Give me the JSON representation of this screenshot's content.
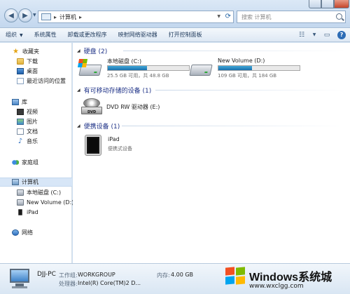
{
  "address": {
    "breadcrumb": "计算机",
    "search_placeholder": "搜索 计算机"
  },
  "toolbar": {
    "organize": "组织",
    "system_properties": "系统属性",
    "uninstall": "卸载或更改程序",
    "map_drive": "映射网络驱动器",
    "control_panel": "打开控制面板"
  },
  "sidebar": {
    "favorites": "收藏夹",
    "downloads": "下载",
    "desktop": "桌面",
    "recent": "最近访问的位置",
    "libraries": "库",
    "videos": "视频",
    "pictures": "图片",
    "documents": "文档",
    "music": "音乐",
    "homegroup": "家庭组",
    "computer": "计算机",
    "local_disk": "本地磁盘 (C:)",
    "new_volume": "New Volume (D:)",
    "ipad": "iPad",
    "network": "网络"
  },
  "content": {
    "hard_disks_header": "硬盘 (2)",
    "removable_header": "有可移动存储的设备 (1)",
    "portable_header": "便携设备 (1)",
    "drives": [
      {
        "name": "本地磁盘 (C:)",
        "space": "25.5 GB 可用，共 48.8 GB",
        "used_fraction": 0.48
      },
      {
        "name": "New Volume (D:)",
        "space": "109 GB 可用，共 184 GB",
        "used_fraction": 0.41
      }
    ],
    "dvd": {
      "name": "DVD RW 驱动器 (E:)",
      "label": "DVD"
    },
    "ipad": {
      "name": "iPad",
      "type": "便携式设备"
    }
  },
  "details": {
    "pc_name": "DJJ-PC",
    "workgroup_label": "工作组:",
    "workgroup_value": "WORKGROUP",
    "memory_label": "内存:",
    "memory_value": "4.00 GB",
    "processor_label": "处理器:",
    "processor_value": "Intel(R) Core(TM)2 D..."
  },
  "watermark": {
    "title": "Windows系统城",
    "url": "www.wxclgg.com"
  },
  "colors": {
    "accent": "#1e3287",
    "bar_fill": "#2689c6",
    "selection": "#d7e6f7"
  }
}
